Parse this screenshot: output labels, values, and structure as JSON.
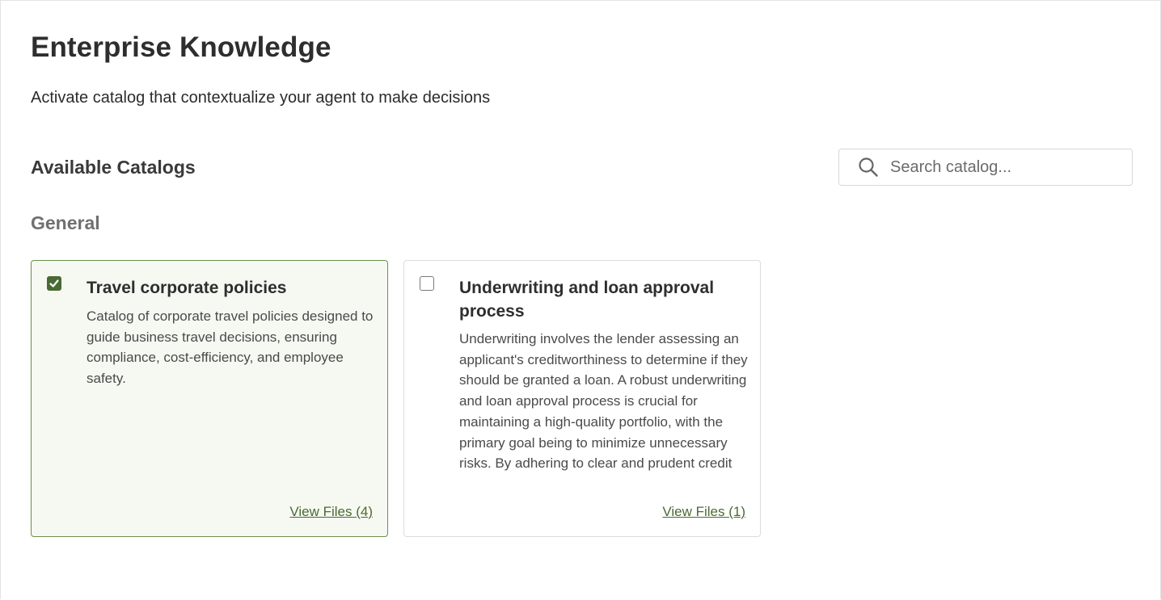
{
  "page": {
    "title": "Enterprise Knowledge",
    "subtitle": "Activate catalog that contextualize your agent to make decisions"
  },
  "catalogs": {
    "section_title": "Available Catalogs",
    "search": {
      "placeholder": "Search catalog...",
      "value": ""
    },
    "groups": [
      {
        "title": "General",
        "items": [
          {
            "title": "Travel corporate policies",
            "description": "Catalog of corporate travel policies designed to guide business travel decisions, ensuring compliance, cost-efficiency, and employee safety.",
            "checked": true,
            "view_files_label": "View Files (4)"
          },
          {
            "title": "Underwriting and loan approval process",
            "description": "Underwriting involves the lender assessing an applicant's creditworthiness to determine if they should be granted a loan. A robust underwriting and loan approval process is crucial for maintaining a high-quality portfolio, with the primary goal being to minimize unnecessary risks. By adhering to clear and prudent credit",
            "checked": false,
            "view_files_label": "View Files (1)"
          }
        ]
      }
    ]
  },
  "colors": {
    "accent": "#4a6a33",
    "selected_border": "#6b8f4e",
    "selected_background": "#f6f9f2"
  },
  "icons": {
    "search": "search-icon",
    "check": "check-icon"
  }
}
